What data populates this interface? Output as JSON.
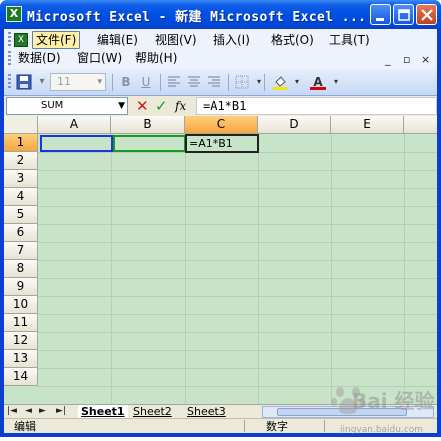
{
  "window": {
    "title": "Microsoft Excel - 新建 Microsoft Excel ...",
    "app_icon": "excel-icon",
    "min_label": "_",
    "max_label": "□",
    "close_label": "×"
  },
  "menu": {
    "row1": [
      {
        "label": "文件(F)",
        "active": true
      },
      {
        "label": "编辑(E)"
      },
      {
        "label": "视图(V)"
      },
      {
        "label": "插入(I)"
      },
      {
        "label": "格式(O)"
      },
      {
        "label": "工具(T)"
      }
    ],
    "row2": [
      {
        "label": "数据(D)"
      },
      {
        "label": "窗口(W)"
      },
      {
        "label": "帮助(H)"
      }
    ],
    "mdi": [
      "_",
      "▫",
      "×"
    ]
  },
  "toolbar": {
    "font_size": "11",
    "bold": "B",
    "underline": "U",
    "font_color": "A",
    "icons": [
      "save-icon",
      "bold-icon",
      "underline-icon",
      "align-left-icon",
      "align-center-icon",
      "align-right-icon",
      "borders-icon",
      "fill-color-icon",
      "font-color-icon"
    ],
    "fill_color": "#f5e600",
    "font_color_value": "#e00000"
  },
  "formula_bar": {
    "name_box": "SUM",
    "fx": "fx",
    "formula": "=A1*B1"
  },
  "grid": {
    "columns": [
      "A",
      "B",
      "C",
      "D",
      "E"
    ],
    "rows": [
      "1",
      "2",
      "3",
      "4",
      "5",
      "6",
      "7",
      "8",
      "9",
      "10",
      "11",
      "12",
      "13",
      "14"
    ],
    "active_column": "C",
    "active_row": "1",
    "cells": {
      "C1": "=A1*B1"
    },
    "reference_colors": {
      "A1": "#1a36d6",
      "B1": "#1a9a22"
    }
  },
  "sheets": {
    "nav": [
      "|◄",
      "◄",
      "►",
      "►|"
    ],
    "tabs": [
      "Sheet1",
      "Sheet2",
      "Sheet3"
    ],
    "active": "Sheet1"
  },
  "status": {
    "mode": "编辑",
    "num": "数字"
  },
  "watermark": {
    "text": "Bai 经验",
    "url": "jingyan.baidu.com"
  }
}
